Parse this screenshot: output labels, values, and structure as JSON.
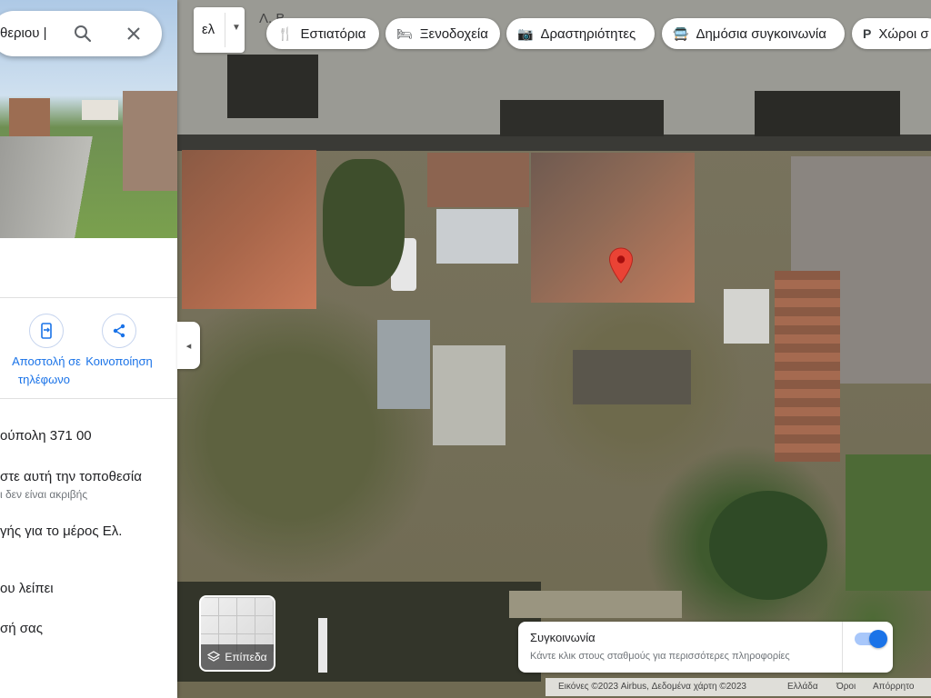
{
  "search": {
    "value": "θεριου |",
    "search_icon": "search-icon",
    "close_icon": "close-icon"
  },
  "map": {
    "partial_street_label": "Λ. Β"
  },
  "language": {
    "label": "ελ"
  },
  "chips": [
    {
      "label": "Εστιατόρια",
      "icon": "restaurant-icon"
    },
    {
      "label": "Ξενοδοχεία",
      "icon": "hotel-icon"
    },
    {
      "label": "Δραστηριότητες",
      "icon": "camera-icon"
    },
    {
      "label": "Δημόσια συγκοινωνία",
      "icon": "transit-icon"
    },
    {
      "label": "Χώροι σ",
      "icon": "parking-icon"
    }
  ],
  "actions": [
    {
      "label1": "Αποστολή σε",
      "label2": "τηλέφωνο",
      "icon": "send-to-phone-icon"
    },
    {
      "label1": "Κοινοποίηση",
      "label2": "",
      "icon": "share-icon"
    }
  ],
  "info": {
    "address": "ούπολη 371 00",
    "location_title": "στε αυτή την τοποθεσία",
    "location_sub": "ι δεν είναι ακριβής",
    "edit": "γής για το μέρος Ελ.",
    "missing": "ου λείπει",
    "yours": "σή σας"
  },
  "layers": {
    "label": "Επίπεδα"
  },
  "transit": {
    "title": "Συγκοινωνία",
    "desc": "Κάντε κλικ στους σταθμούς για περισσότερες πληροφορίες",
    "enabled": true
  },
  "footer": {
    "imagery": "Εικόνες ©2023 Airbus, Δεδομένα χάρτη ©2023",
    "country": "Ελλάδα",
    "terms": "Όροι",
    "privacy": "Απόρρητο"
  },
  "colors": {
    "accent": "#1a73e8",
    "pin": "#ea4335"
  }
}
